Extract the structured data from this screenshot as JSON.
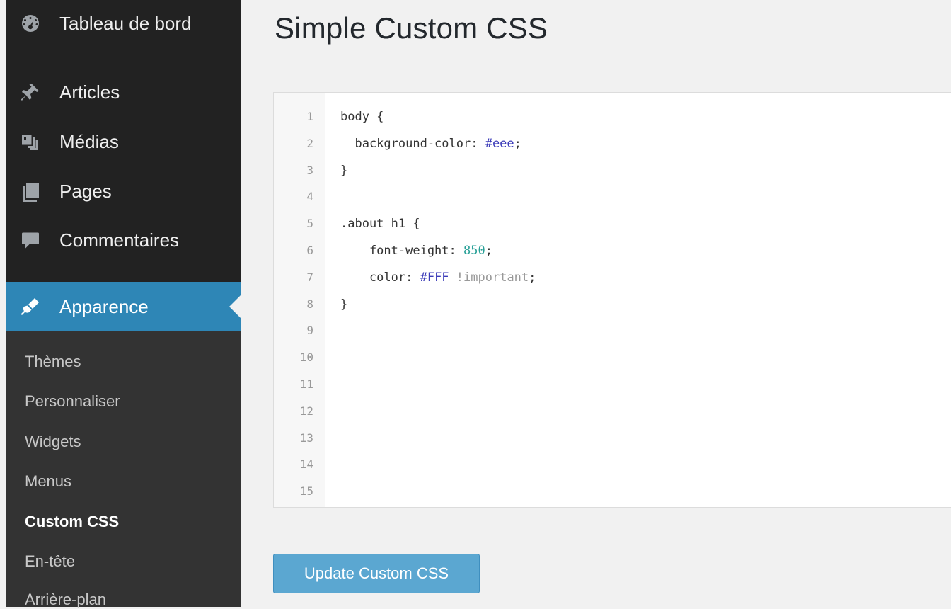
{
  "sidebar": {
    "items": [
      {
        "label": "Tableau de bord",
        "icon": "dashboard-icon"
      },
      {
        "label": "Articles",
        "icon": "pin-icon"
      },
      {
        "label": "Médias",
        "icon": "media-icon"
      },
      {
        "label": "Pages",
        "icon": "pages-icon"
      },
      {
        "label": "Commentaires",
        "icon": "comment-icon"
      },
      {
        "label": "Apparence",
        "icon": "brush-icon",
        "active": true
      }
    ],
    "submenu": [
      {
        "label": "Thèmes"
      },
      {
        "label": "Personnaliser"
      },
      {
        "label": "Widgets"
      },
      {
        "label": "Menus"
      },
      {
        "label": "Custom CSS",
        "current": true
      },
      {
        "label": "En-tête"
      },
      {
        "label": "Arrière-plan"
      }
    ]
  },
  "main": {
    "title": "Simple Custom CSS",
    "editor": {
      "line_numbers": [
        "1",
        "2",
        "3",
        "4",
        "5",
        "6",
        "7",
        "8",
        "9",
        "10",
        "11",
        "12",
        "13",
        "14",
        "15"
      ],
      "lines": [
        [
          "body {"
        ],
        [
          "  background-color: ",
          "#eee",
          ";"
        ],
        [
          "}"
        ],
        [
          ""
        ],
        [
          ".about h1 {"
        ],
        [
          "    font-weight: ",
          "850",
          ";"
        ],
        [
          "    color: ",
          "#FFF",
          " ",
          "!important",
          ";"
        ],
        [
          "}"
        ],
        [
          ""
        ],
        [
          ""
        ],
        [
          ""
        ],
        [
          ""
        ],
        [
          ""
        ],
        [
          ""
        ],
        [
          ""
        ]
      ]
    },
    "update_button_label": "Update Custom CSS"
  },
  "colors": {
    "sidebar_bg": "#222222",
    "submenu_bg": "#333333",
    "active_bg": "#2e86b6",
    "button_bg": "#5ba7d1",
    "hex_token": "#3a3ab8",
    "number_token": "#2aa198"
  }
}
